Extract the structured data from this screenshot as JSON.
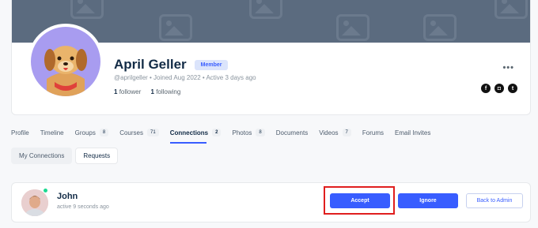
{
  "profile": {
    "name": "April Geller",
    "role_badge": "Member",
    "meta": "@aprilgeller • Joined Aug 2022 • Active 3 days ago",
    "followers_count": "1",
    "followers_label": "follower",
    "following_count": "1",
    "following_label": "following",
    "more": "•••",
    "social": [
      "facebook-icon",
      "instagram-icon",
      "twitter-icon"
    ]
  },
  "nav": {
    "items": [
      {
        "label": "Profile"
      },
      {
        "label": "Timeline"
      },
      {
        "label": "Groups",
        "count": "8"
      },
      {
        "label": "Courses",
        "count": "71"
      },
      {
        "label": "Connections",
        "count": "2",
        "active": true
      },
      {
        "label": "Photos",
        "count": "8"
      },
      {
        "label": "Documents"
      },
      {
        "label": "Videos",
        "count": "7"
      },
      {
        "label": "Forums"
      },
      {
        "label": "Email Invites"
      }
    ]
  },
  "subtabs": [
    "My Connections",
    "Requests"
  ],
  "request": {
    "name": "John",
    "time": "active 9 seconds ago",
    "accept": "Accept",
    "ignore": "Ignore",
    "back": "Back to Admin"
  },
  "colors": {
    "primary": "#385dff",
    "cover": "#5b6b7f",
    "avatar_bg": "#a89cf0",
    "highlight": "#e01e1e",
    "online": "#1cd991"
  }
}
